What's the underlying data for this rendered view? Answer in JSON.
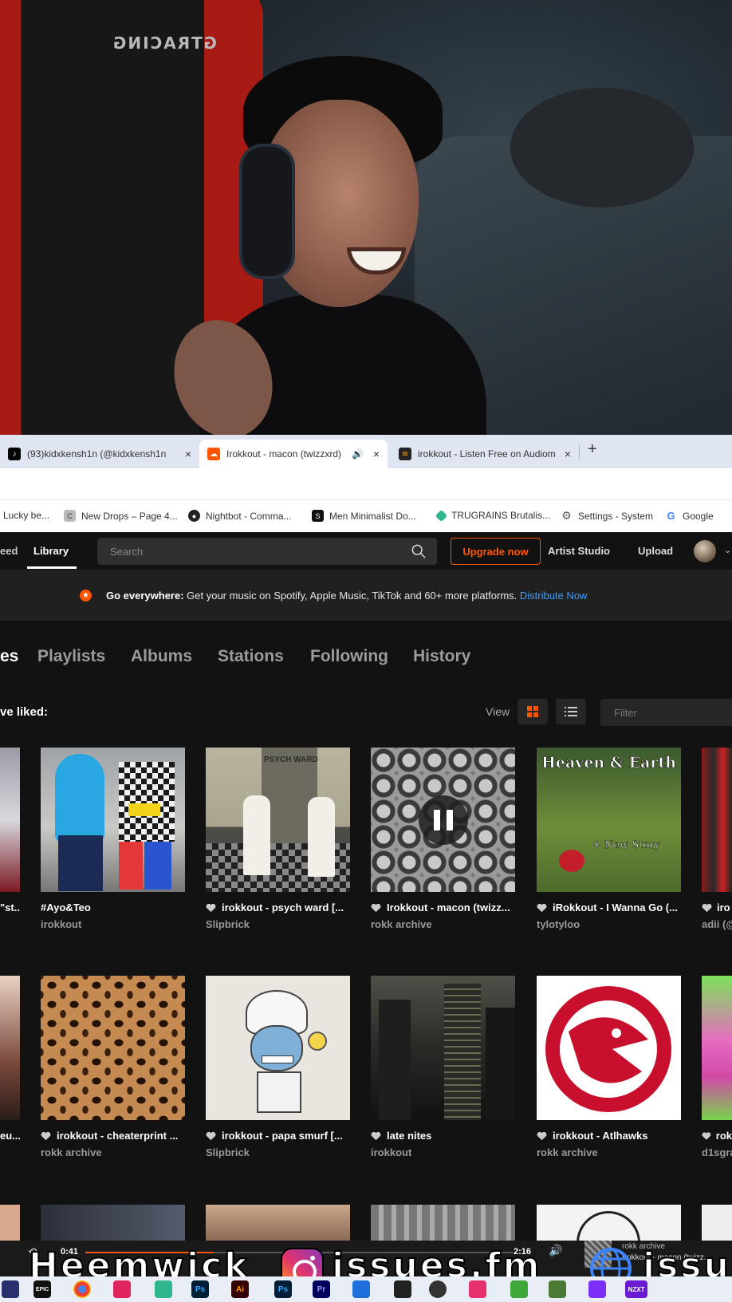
{
  "webcam": {
    "chair_logo": "GTRACING"
  },
  "browser": {
    "tabs": [
      {
        "label": "(93)kidxkensh1n (@kidxkensh1n",
        "favicon": "tiktok-icon"
      },
      {
        "label": "Irokkout - macon (twizzxrd)",
        "favicon": "soundcloud-icon",
        "active": true
      },
      {
        "label": "irokkout - Listen Free on Audiomack",
        "favicon": "audiomack-icon"
      }
    ],
    "new_tab": "+",
    "close_glyph": "×",
    "bookmarks": [
      {
        "label": "Lucky be...",
        "icon": "bookmark-icon"
      },
      {
        "label": "New Drops – Page 4...",
        "icon": "c-icon"
      },
      {
        "label": "Nightbot - Comma...",
        "icon": "nightbot-icon"
      },
      {
        "label": "Men Minimalist Do...",
        "icon": "s-icon"
      },
      {
        "label": "TRUGRAINS Brutalis...",
        "icon": "trugrains-icon"
      },
      {
        "label": "Settings - System",
        "icon": "gear-icon"
      },
      {
        "label": "Google",
        "icon": "google-icon"
      }
    ]
  },
  "header": {
    "nav_feed": "eed",
    "nav_library": "Library",
    "search_placeholder": "Search",
    "upgrade": "Upgrade now",
    "artist_studio": "Artist Studio",
    "upload": "Upload"
  },
  "banner": {
    "bold": "Go everywhere:",
    "text": " Get your music on Spotify, Apple Music, TikTok and 60+ more platforms. ",
    "link": "Distribute Now"
  },
  "library_tabs": [
    "es",
    "Playlists",
    "Albums",
    "Stations",
    "Following",
    "History"
  ],
  "liked_heading": "ve liked:",
  "view_label": "View",
  "filter_placeholder": "Filter",
  "rows": [
    {
      "left_partial": {
        "title": "\"st..."
      },
      "tiles": [
        {
          "title": "#Ayo&Teo",
          "artist": "irokkout"
        },
        {
          "title": "irokkout - psych ward [...",
          "artist": "Slipbrick",
          "art_text": "PSYCH WARD"
        },
        {
          "title": "Irokkout - macon (twizz...",
          "artist": "rokk archive",
          "playing": true
        },
        {
          "title": "iRokkout - I Wanna Go (...",
          "artist": "tylotyloo",
          "art_text": "Heaven & Earth",
          "art_sub": "+ New Story"
        }
      ],
      "right_partial": {
        "title": "iro",
        "artist": "adii (@"
      }
    },
    {
      "left_partial": {
        "title": "eu..."
      },
      "tiles": [
        {
          "title": "irokkout - cheaterprint ...",
          "artist": "rokk archive"
        },
        {
          "title": "irokkout - papa smurf [...",
          "artist": "Slipbrick"
        },
        {
          "title": "late nites",
          "artist": "irokkout"
        },
        {
          "title": "irokkout - Atlhawks",
          "artist": "rokk archive"
        }
      ],
      "right_partial": {
        "title": "rok",
        "artist": "d1sgra"
      }
    }
  ],
  "player": {
    "elapsed": "0:41",
    "duration": "2:16",
    "progress": 0.3,
    "artist": "rokk archive",
    "title": "Irokkout - macon (twizz..."
  },
  "overlay": {
    "left": "Heemwick",
    "middle": "issues.fm",
    "right": "issue"
  },
  "taskbar": {
    "apps": [
      "EPIC",
      "Ps",
      "Ai",
      "Ps",
      "Pr",
      "NZXT"
    ]
  },
  "colors": {
    "accent": "#ff5500",
    "link": "#3a9cff",
    "background": "#121212"
  }
}
